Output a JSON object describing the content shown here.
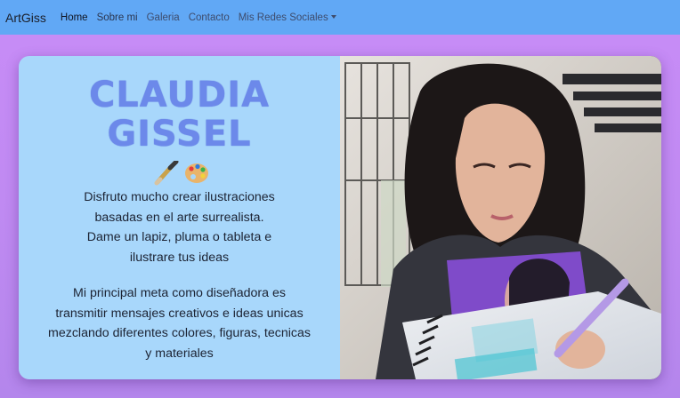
{
  "navbar": {
    "brand": "ArtGiss",
    "links": [
      {
        "label": "Home"
      },
      {
        "label": "Sobre mi"
      },
      {
        "label": "Galeria"
      },
      {
        "label": "Contacto"
      },
      {
        "label": "Mis Redes Sociales"
      }
    ]
  },
  "hero": {
    "title_line1": "CLAUDIA",
    "title_line2": "GISSEL",
    "decor_icons": [
      "paintbrush-icon",
      "palette-icon"
    ],
    "paragraph1": [
      "Disfruto mucho crear ilustraciones",
      "basadas en el arte surrealista.",
      "Dame un lapiz, pluma o tableta e",
      "ilustrare tus ideas"
    ],
    "paragraph2": [
      "Mi principal meta como diseñadora es",
      "transmitir mensajes creativos e ideas unicas",
      "mezclando diferentes colores, figuras, tecnicas",
      "y materiales"
    ]
  },
  "colors": {
    "navbar": "#61a8f5",
    "background": "#c08af2",
    "left_panel": "#a8d7fb",
    "title": "#6c89ea"
  }
}
